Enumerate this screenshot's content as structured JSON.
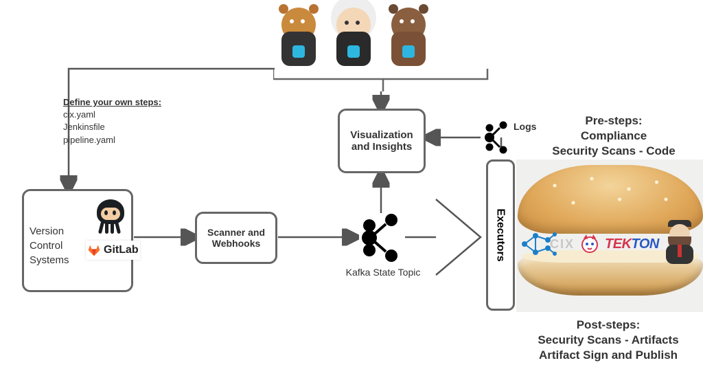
{
  "define_steps": {
    "heading": "Define your own steps:",
    "items": [
      "cix.yaml",
      "Jenkinsfile",
      "pipeline.yaml"
    ]
  },
  "vcs": {
    "line1": "Version",
    "line2": "Control",
    "line3": "Systems",
    "gitlab_label": "GitLab"
  },
  "scanner_box": "Scanner and Webhooks",
  "kafka_label": "Kafka State Topic",
  "viz_box": "Visualization and Insights",
  "logs_label": "Logs",
  "executors_label": "Executors",
  "pre_steps": {
    "heading": "Pre-steps:",
    "line1": "Compliance",
    "line2": "Security Scans - Code"
  },
  "post_steps": {
    "heading": "Post-steps:",
    "line1": "Security Scans - Artifacts",
    "line2": "Artifact Sign and Publish"
  },
  "burger_logos": {
    "cix": "CIX",
    "tekton_part1": "TEK",
    "tekton_part2": "TON"
  },
  "icons": {
    "kafka": "kafka-cluster-icon",
    "logs": "kafka-logs-icon",
    "octocat": "github-octocat",
    "gitlab": "gitlab-logo",
    "mascots": [
      "salesforce-mascot-1",
      "salesforce-mascot-einstein",
      "salesforce-mascot-astro"
    ],
    "jenkins": "jenkins-butler",
    "tekton_cat": "tekton-cat",
    "cix_net": "cix-network-graph"
  }
}
